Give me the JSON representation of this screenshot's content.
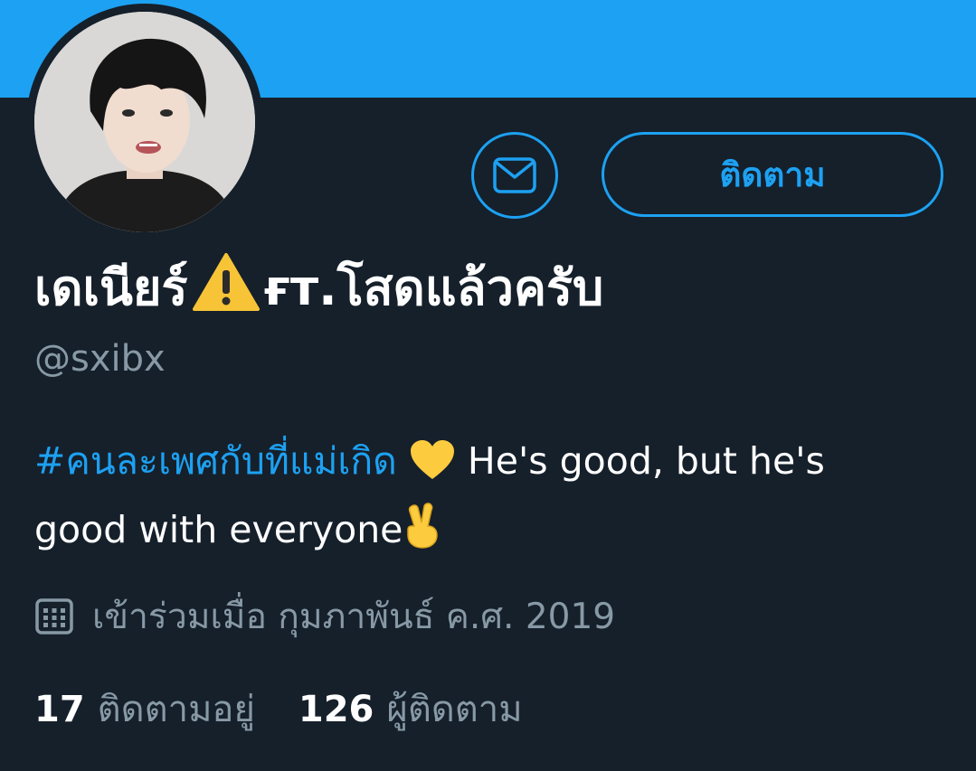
{
  "profile": {
    "display_name_part1": "เดเนียร์",
    "display_name_part2": "ғт.โสดแล้วครับ",
    "handle": "@sxibx",
    "bio_hashtag": "#คนละเพศกับที่แม่เกิด",
    "bio_text_line1": "He's good, but he's",
    "bio_text_line2": "good with everyone",
    "joined": "เข้าร่วมเมื่อ กุมภาพันธ์ ค.ศ. 2019"
  },
  "actions": {
    "follow_label": "ติดตาม",
    "message_icon": "envelope-icon"
  },
  "stats": {
    "following_count": "17",
    "following_label": "ติดตามอยู่",
    "followers_count": "126",
    "followers_label": "ผู้ติดตาม"
  },
  "icons": {
    "warning": "warning-icon",
    "heart": "yellow-heart-icon",
    "victory": "victory-hand-icon",
    "calendar": "calendar-icon"
  },
  "colors": {
    "accent": "#1da1f2",
    "background": "#15202b",
    "muted": "#8899a6",
    "text": "#ffffff"
  }
}
